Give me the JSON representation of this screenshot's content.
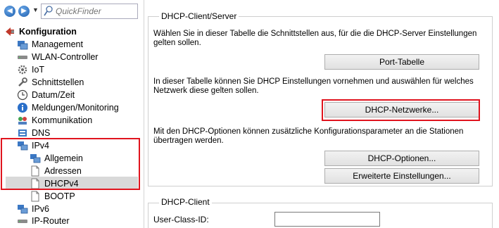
{
  "search": {
    "placeholder": "QuickFinder"
  },
  "sidebar": {
    "root": "Konfiguration",
    "items": [
      {
        "label": "Management",
        "icon": "management-icon"
      },
      {
        "label": "WLAN-Controller",
        "icon": "wlan-controller-icon"
      },
      {
        "label": "IoT",
        "icon": "gear-icon"
      },
      {
        "label": "Schnittstellen",
        "icon": "wrench-icon"
      },
      {
        "label": "Datum/Zeit",
        "icon": "clock-icon"
      },
      {
        "label": "Meldungen/Monitoring",
        "icon": "info-icon"
      },
      {
        "label": "Kommunikation",
        "icon": "communication-icon"
      },
      {
        "label": "DNS",
        "icon": "dns-icon"
      },
      {
        "label": "IPv4",
        "icon": "network-icon"
      },
      {
        "label": "Allgemein",
        "icon": "network-icon"
      },
      {
        "label": "Adressen",
        "icon": "page-icon"
      },
      {
        "label": "DHCPv4",
        "icon": "page-icon"
      },
      {
        "label": "BOOTP",
        "icon": "page-icon"
      },
      {
        "label": "IPv6",
        "icon": "network-icon"
      },
      {
        "label": "IP-Router",
        "icon": "router-icon"
      }
    ]
  },
  "main": {
    "group1": {
      "title": "DHCP-Client/Server",
      "text1": "Wählen Sie in dieser Tabelle die Schnittstellen aus, für die die DHCP-Server Einstellungen gelten sollen.",
      "button1": "Port-Tabelle",
      "text2": "In dieser Tabelle können Sie DHCP Einstellungen vornehmen und auswählen für welches Netzwerk diese gelten sollen.",
      "button2": "DHCP-Netzwerke...",
      "text3": "Mit den DHCP-Optionen können zusätzliche Konfigurationsparameter an die Stationen übertragen werden.",
      "button3": "DHCP-Optionen...",
      "button4": "Erweiterte Einstellungen..."
    },
    "group2": {
      "title": "DHCP-Client",
      "field_label": "User-Class-ID:",
      "field_value": ""
    }
  },
  "colors": {
    "highlight": "#e0141e",
    "selection": "#d9d9d9"
  }
}
